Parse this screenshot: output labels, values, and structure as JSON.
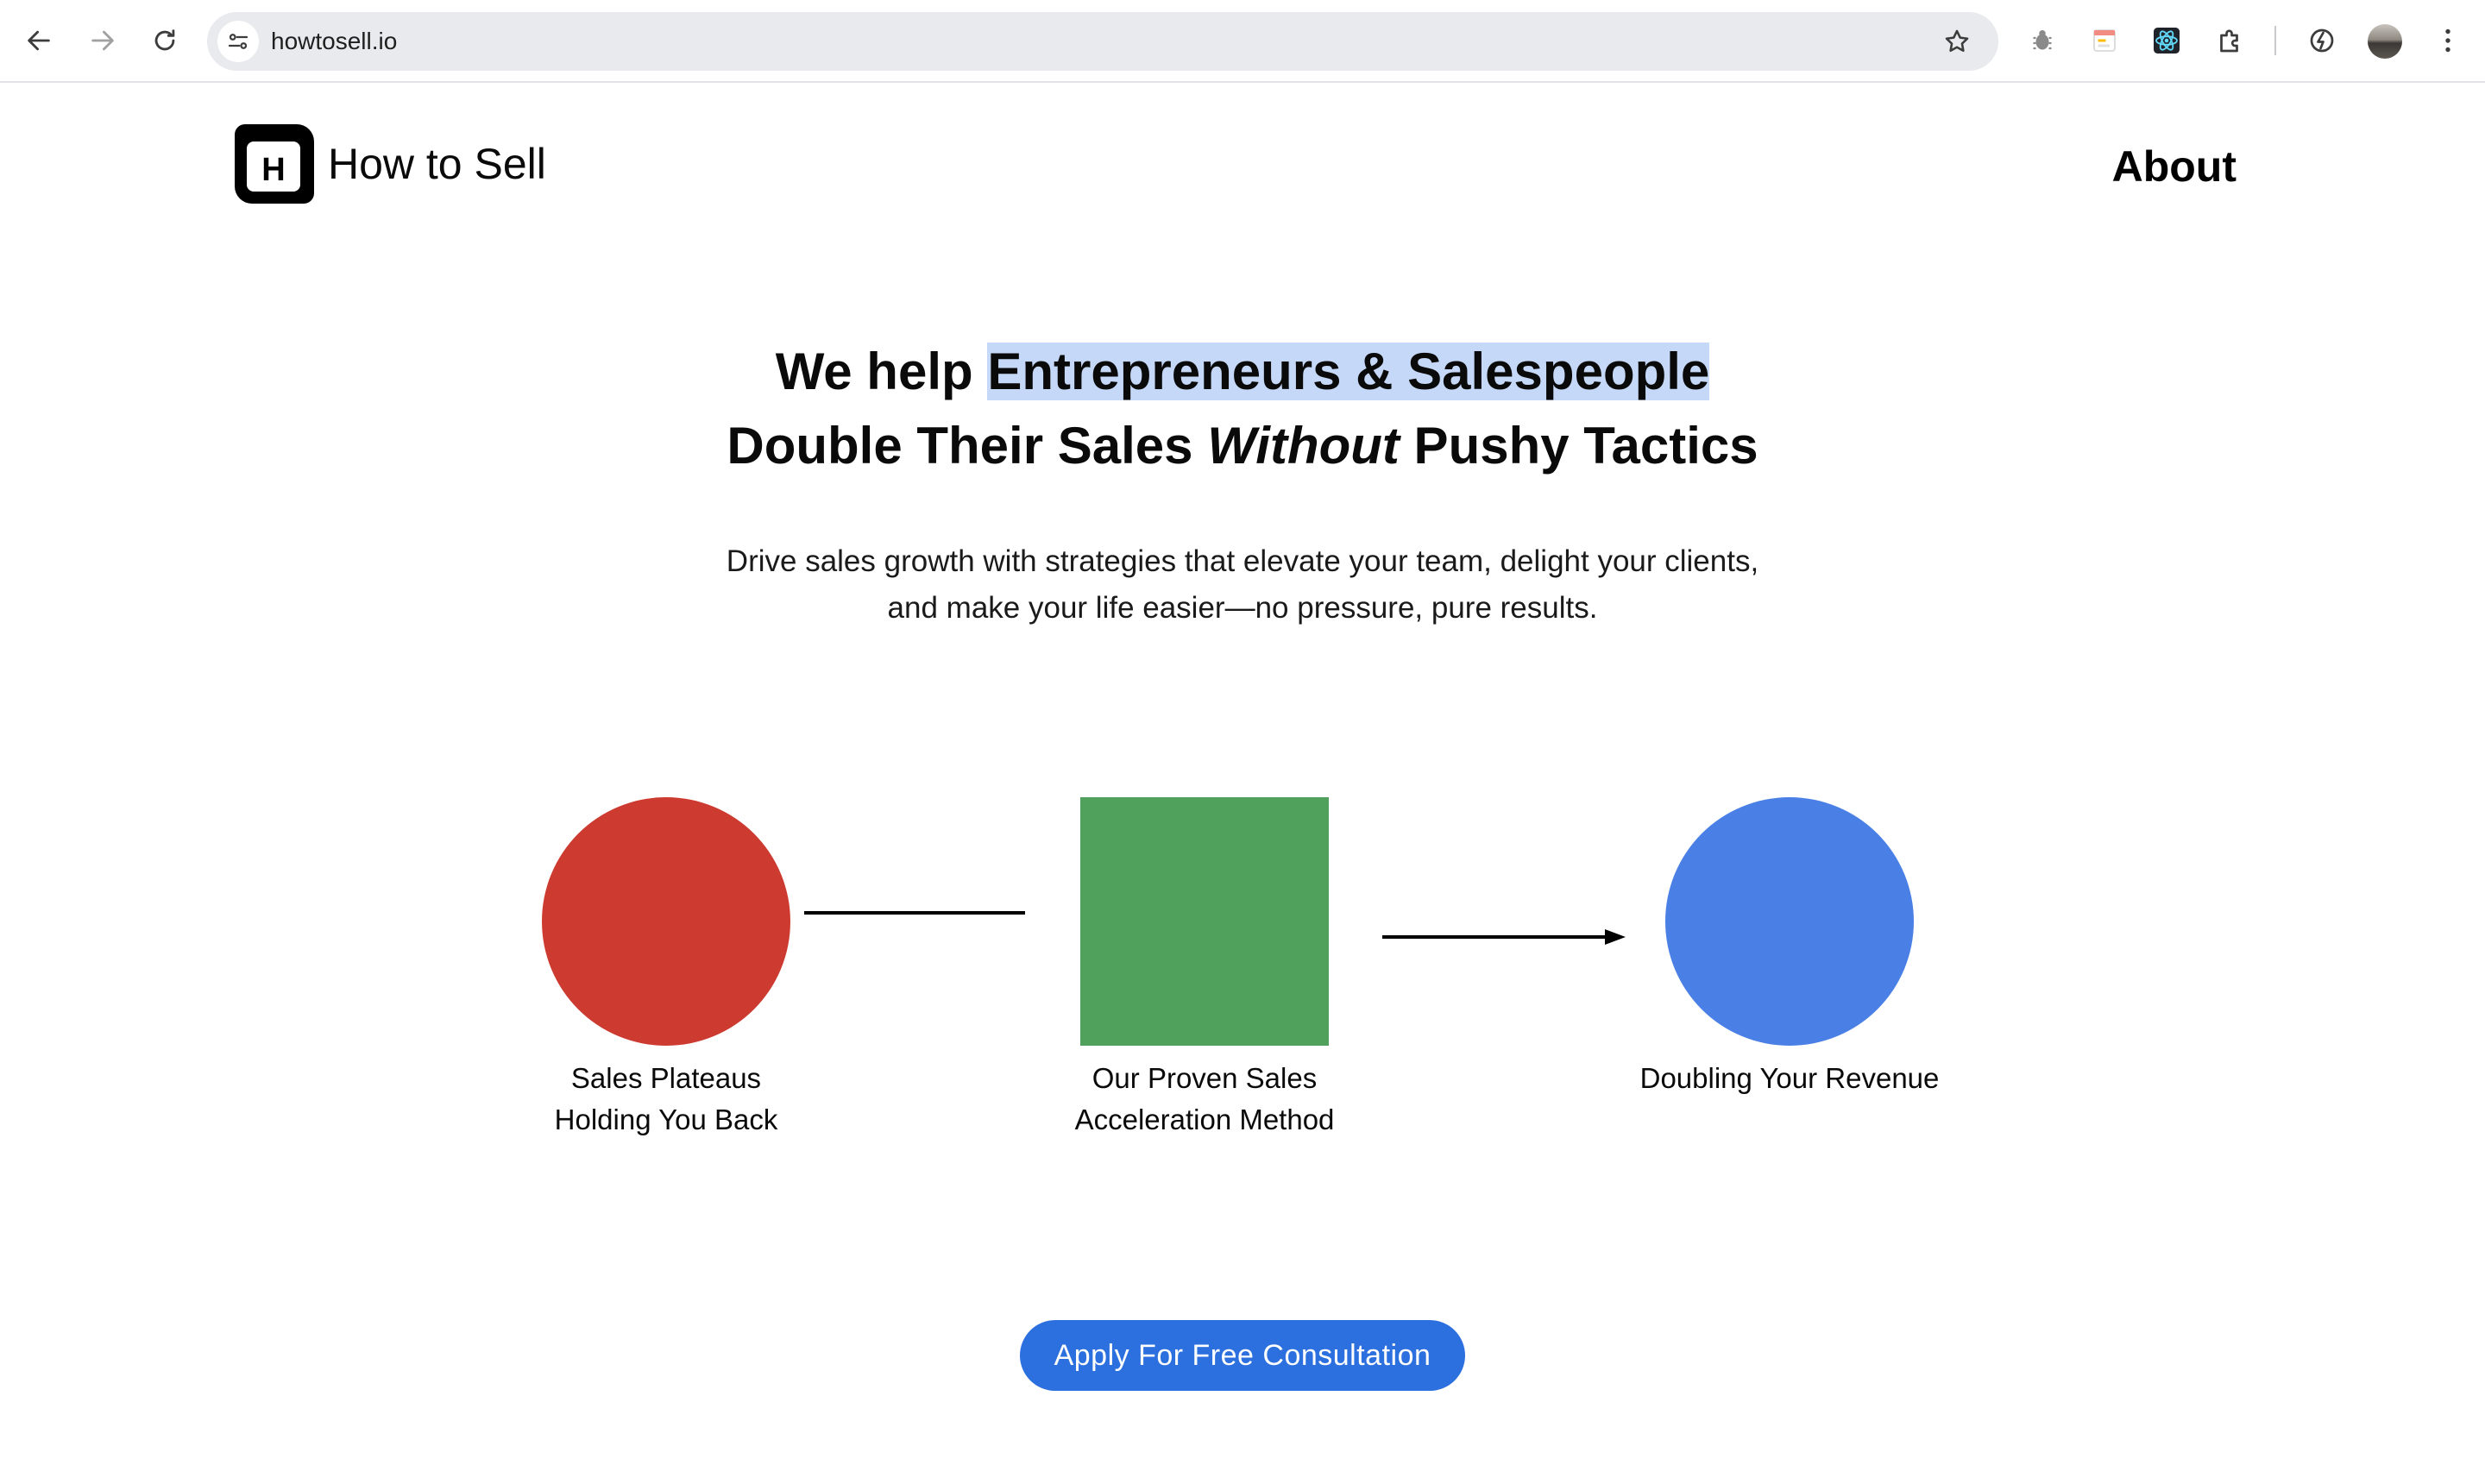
{
  "browser": {
    "url": "howtosell.io",
    "nav_icons": [
      "back-arrow-icon",
      "forward-arrow-icon",
      "reload-icon"
    ],
    "extension_icons": [
      "bug-icon",
      "calendar-extension-icon",
      "react-devtools-icon",
      "puzzle-extensions-icon",
      "performance-extension-icon"
    ]
  },
  "header": {
    "logo_letter": "H",
    "brand_name": "How to Sell",
    "nav_about": "About"
  },
  "hero": {
    "title_prefix": "We help ",
    "title_highlight": "Entrepreneurs & Salespeople",
    "title_line2_a": "Double Their Sales ",
    "title_line2_em": "Without",
    "title_line2_b": " Pushy Tactics",
    "subtitle_line1": "Drive sales growth with strategies that elevate your team, delight your clients,",
    "subtitle_line2": "and make your life easier—no pressure, pure results."
  },
  "diagram": {
    "steps": [
      {
        "line1": "Sales Plateaus",
        "line2": "Holding You Back",
        "color": "#cc3a30",
        "shape": "circle"
      },
      {
        "line1": "Our Proven Sales",
        "line2": "Acceleration Method",
        "color": "#4fa15c",
        "shape": "square"
      },
      {
        "line1": "Doubling Your Revenue",
        "line2": "",
        "color": "#4a80e6",
        "shape": "circle"
      }
    ]
  },
  "cta": {
    "label": "Apply For Free Consultation",
    "color": "#2c6fde"
  },
  "colors": {
    "highlight": "#c5d8f7",
    "omnibox": "#e9eaed"
  }
}
